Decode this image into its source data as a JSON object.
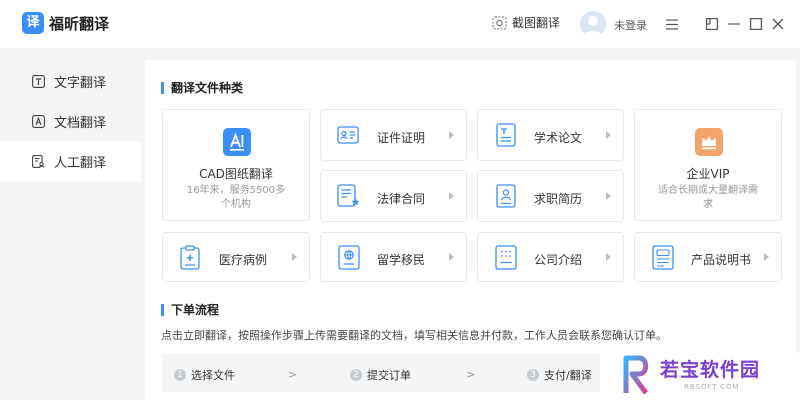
{
  "app": {
    "logo_glyph": "译",
    "name": "福昕翻译",
    "accent": "#3a8ef6"
  },
  "header": {
    "screenshot_label": "截图翻译",
    "login_label": "未登录"
  },
  "sidebar": {
    "items": [
      {
        "label": "文字翻译",
        "icon": "text-t-icon"
      },
      {
        "label": "文档翻译",
        "icon": "document-a-icon"
      },
      {
        "label": "人工翻译",
        "icon": "human-translate-icon",
        "active": true
      }
    ]
  },
  "types": {
    "title": "翻译文件种类",
    "cad": {
      "title": "CAD图纸翻译",
      "desc": "16年来，服务5500多个机构"
    },
    "vip": {
      "title": "企业VIP",
      "desc": "适合长期或大量翻译需求"
    },
    "items": [
      {
        "label": "证件证明",
        "icon": "id-card-icon"
      },
      {
        "label": "学术论文",
        "icon": "paper-icon"
      },
      {
        "label": "法律合同",
        "icon": "contract-icon"
      },
      {
        "label": "求职简历",
        "icon": "resume-icon"
      },
      {
        "label": "医疗病例",
        "icon": "medical-record-icon"
      },
      {
        "label": "留学移民",
        "icon": "passport-icon"
      },
      {
        "label": "公司介绍",
        "icon": "company-icon"
      },
      {
        "label": "产品说明书",
        "icon": "manual-icon"
      }
    ]
  },
  "process": {
    "title": "下单流程",
    "desc": "点击立即翻译，按照操作步骤上传需要翻译的文档，填写相关信息并付款，工作人员会联系您确认订单。",
    "steps": [
      {
        "num": "1",
        "label": "选择文件"
      },
      {
        "num": "2",
        "label": "提交订单"
      },
      {
        "num": "3",
        "label": "支付/翻译"
      }
    ],
    "separator": ">"
  },
  "watermark": {
    "text": "若宝软件园",
    "sub": "RBSOFT.COM"
  }
}
